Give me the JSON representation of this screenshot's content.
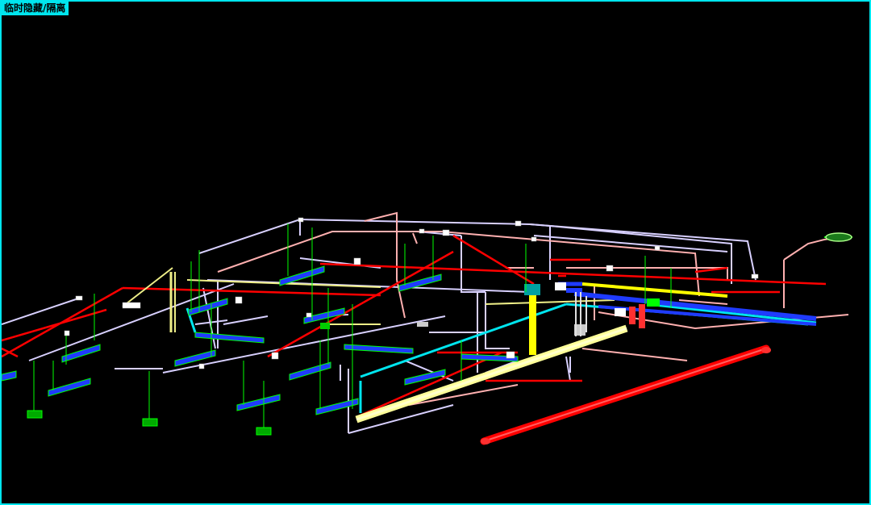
{
  "window": {
    "mode_label": "临时隐藏/隔离"
  },
  "colors": {
    "frame": "#00e5ee",
    "background": "#000000",
    "fire_pipe": "#ff0000",
    "sprinkler_branch": "#d8d0ff",
    "supply_pipe": "#ffb0b0",
    "drop_line": "#00ff00",
    "cable_tray": "#1f3bff",
    "duct": "#ffff99",
    "cyan_pipe": "#00e5ee",
    "yellow_riser": "#ffff00"
  },
  "icons": [
    "sprinkler-head-icon",
    "pipe-valve-icon",
    "support-base-icon"
  ]
}
